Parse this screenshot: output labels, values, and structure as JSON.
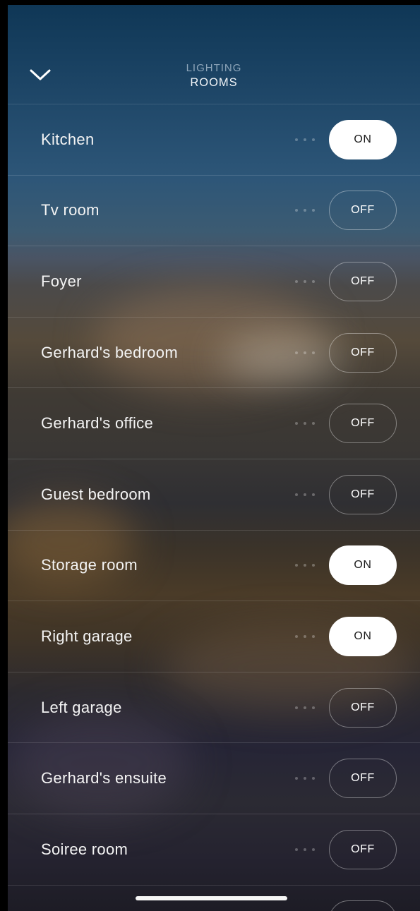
{
  "header": {
    "subtitle": "LIGHTING",
    "title": "ROOMS",
    "back_icon": "chevron-down-icon"
  },
  "rooms": [
    {
      "label": "Kitchen",
      "state": "ON"
    },
    {
      "label": "Tv room",
      "state": "OFF"
    },
    {
      "label": "Foyer",
      "state": "OFF"
    },
    {
      "label": "Gerhard's bedroom",
      "state": "OFF"
    },
    {
      "label": "Gerhard's office",
      "state": "OFF"
    },
    {
      "label": "Guest bedroom",
      "state": "OFF"
    },
    {
      "label": "Storage room",
      "state": "ON"
    },
    {
      "label": "Right garage",
      "state": "ON"
    },
    {
      "label": "Left garage",
      "state": "OFF"
    },
    {
      "label": "Gerhard's ensuite",
      "state": "OFF"
    },
    {
      "label": "Soiree room",
      "state": "OFF"
    },
    {
      "label": "",
      "state": ""
    }
  ],
  "row_menu_icon": "more-dots-icon",
  "colors": {
    "toggle_on_bg": "#ffffff",
    "toggle_on_text": "#1b1b1b",
    "toggle_off_border": "rgba(255,255,255,0.38)",
    "subtitle": "#8ea6ba"
  }
}
